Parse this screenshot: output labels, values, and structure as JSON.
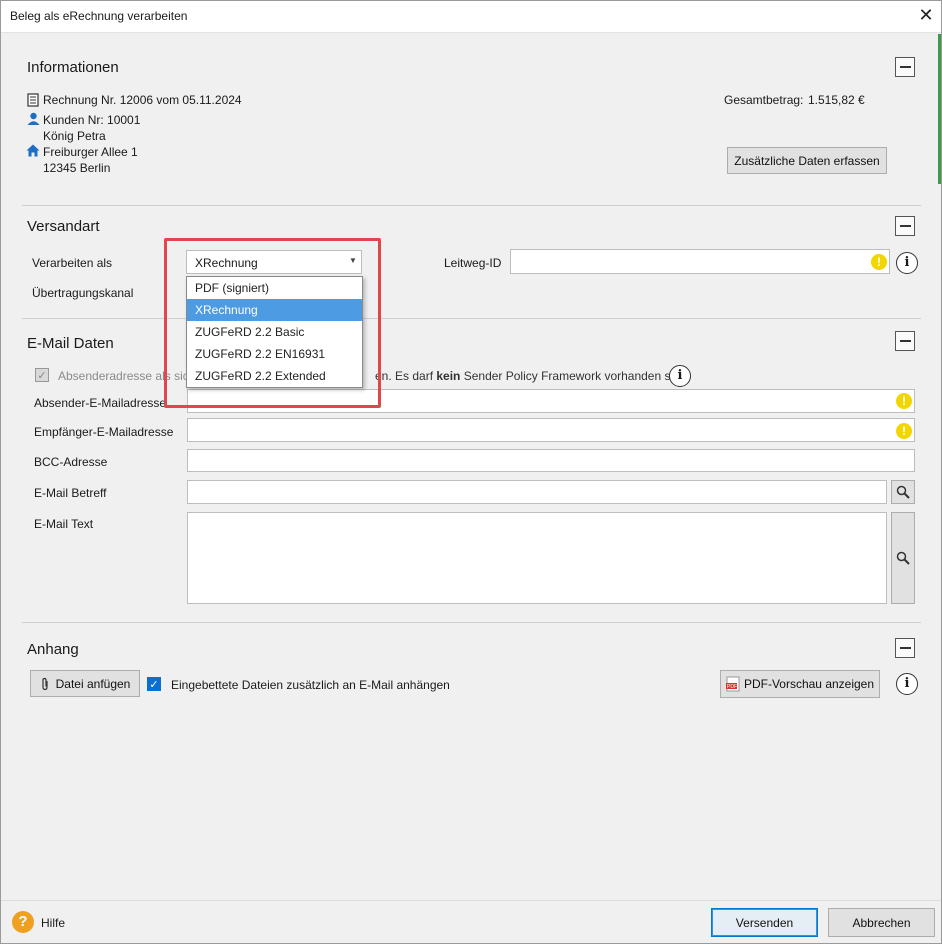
{
  "window": {
    "title": "Beleg als eRechnung verarbeiten"
  },
  "info": {
    "title": "Informationen",
    "invoice": "Rechnung Nr. 12006 vom 05.11.2024",
    "customer_no": "Kunden Nr: 10001",
    "customer_name": "König Petra",
    "street": "Freiburger Allee 1",
    "city": "12345 Berlin",
    "total_label": "Gesamtbetrag:",
    "total_value": "1.515,82 €",
    "extra_button": "Zusätzliche Daten erfassen"
  },
  "shipping": {
    "title": "Versandart",
    "process_label": "Verarbeiten als",
    "process_value": "XRechnung",
    "channel_label": "Übertragungskanal",
    "leitweg_label": "Leitweg-ID",
    "leitweg_value": "",
    "options": [
      "PDF (signiert)",
      "XRechnung",
      "ZUGFeRD 2.2 Basic",
      "ZUGFeRD 2.2 EN16931",
      "ZUGFeRD 2.2 Extended"
    ],
    "selected_index": 1
  },
  "email": {
    "title": "E-Mail Daten",
    "sender_check_prefix": "Absenderadresse als sich",
    "sender_check_suffix_a": "en. Es darf ",
    "sender_check_bold": "kein",
    "sender_check_suffix_b": " Sender Policy Framework vorhanden sein.",
    "sender_label": "Absender-E-Mailadresse",
    "sender_value": "",
    "recipient_label": "Empfänger-E-Mailadresse",
    "recipient_value": "",
    "bcc_label": "BCC-Adresse",
    "bcc_value": "",
    "subject_label": "E-Mail Betreff",
    "subject_value": "",
    "text_label": "E-Mail Text",
    "text_value": ""
  },
  "attachment": {
    "title": "Anhang",
    "attach_button": "Datei anfügen",
    "embedded_check": "Eingebettete Dateien zusätzlich an E-Mail anhängen",
    "embedded_checked": true,
    "preview_button": "PDF-Vorschau anzeigen"
  },
  "footer": {
    "help": "Hilfe",
    "send": "Versenden",
    "cancel": "Abbrechen"
  },
  "colors": {
    "accent_green": "#3d9b47",
    "selection_blue": "#4d9be2",
    "highlight_red": "#e0474c",
    "warning_yellow": "#f2d600",
    "help_orange": "#f0a020"
  },
  "icons": {
    "invoice": "document-icon",
    "customer": "person-icon",
    "address": "home-icon",
    "search": "magnifier-icon",
    "attach": "paperclip-icon",
    "pdf": "pdf-icon",
    "help": "question-icon"
  }
}
